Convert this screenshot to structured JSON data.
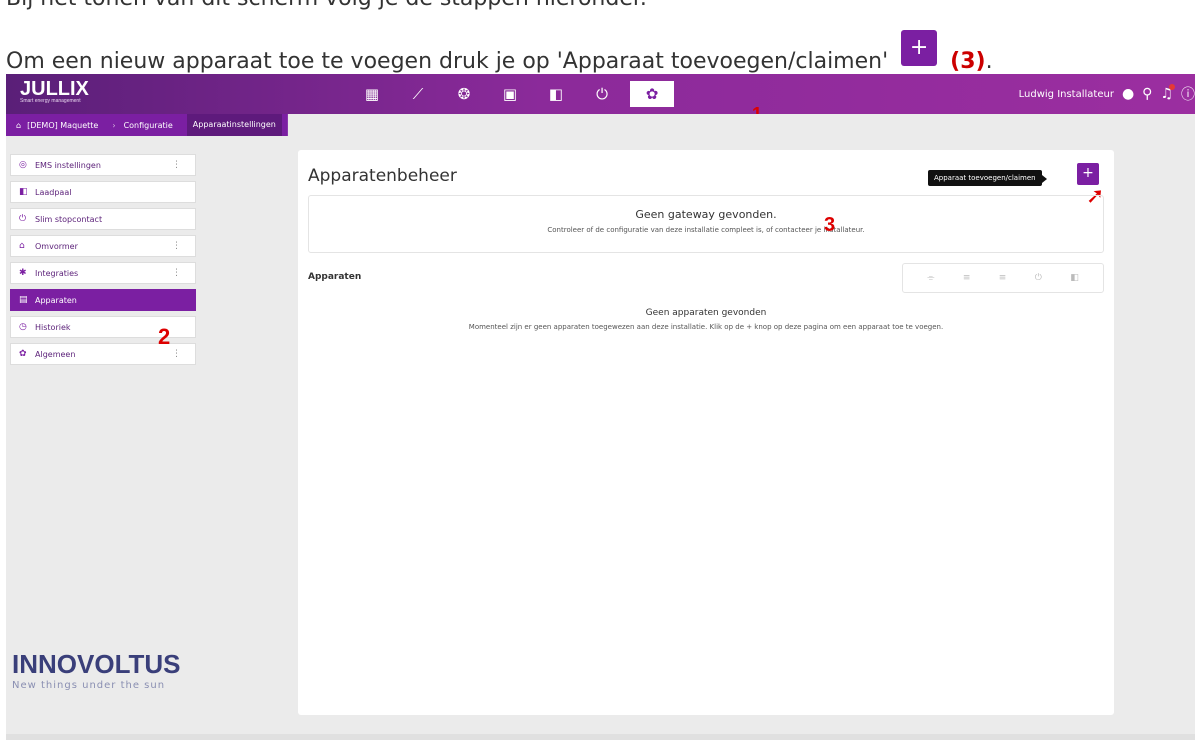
{
  "doc": {
    "top_line": "Bij het tonen van dit scherm volg je de stappen hieronder.",
    "instruction_prefix": "Om een nieuw apparaat toe te voegen druk je op 'Apparaat toevoegen/claimen'",
    "instruction_ref": "(3)",
    "instruction_suffix": "."
  },
  "app": {
    "logo": "JULLIX",
    "logo_tagline": "Smart energy management",
    "nav": [
      {
        "icon": "dashboard-icon",
        "glyph": "▦"
      },
      {
        "icon": "chart-icon",
        "glyph": "⟋"
      },
      {
        "icon": "brain-icon",
        "glyph": "❂"
      },
      {
        "icon": "battery-icon",
        "glyph": "▣"
      },
      {
        "icon": "charger-icon",
        "glyph": "◧"
      },
      {
        "icon": "plug-icon",
        "glyph": "⏻"
      },
      {
        "icon": "settings-icon",
        "glyph": "✿"
      }
    ],
    "markers": {
      "one": "1",
      "two": "2",
      "three": "3"
    },
    "user": {
      "name": "Ludwig Installateur"
    },
    "breadcrumbs": [
      "[DEMO] Maquette",
      "Configuratie",
      "Apparaatinstellingen"
    ],
    "sidebar": [
      {
        "label": "EMS instellingen",
        "glyph": "◎",
        "icon": "ems-icon",
        "more": "⋮"
      },
      {
        "label": "Laadpaal",
        "glyph": "◧",
        "icon": "charger-icon",
        "more": ""
      },
      {
        "label": "Slim stopcontact",
        "glyph": "⏻",
        "icon": "plug-icon",
        "more": ""
      },
      {
        "label": "Omvormer",
        "glyph": "⌂",
        "icon": "inverter-icon",
        "more": "⋮"
      },
      {
        "label": "Integraties",
        "glyph": "✱",
        "icon": "puzzle-icon",
        "more": "⋮"
      },
      {
        "label": "Apparaten",
        "glyph": "▤",
        "icon": "devices-icon",
        "more": ""
      },
      {
        "label": "Historiek",
        "glyph": "◷",
        "icon": "history-icon",
        "more": ""
      },
      {
        "label": "Algemeen",
        "glyph": "✿",
        "icon": "gear-icon",
        "more": "⋮"
      }
    ],
    "brand": {
      "name": "INNOVOLTUS",
      "slogan": "New things under the sun"
    },
    "main": {
      "title": "Apparatenbeheer",
      "tooltip": "Apparaat toevoegen/claimen",
      "add_label": "+",
      "notice_title": "Geen gateway gevonden.",
      "notice_text": "Controleer of de configuratie van deze installatie compleet is, of contacteer je installateur.",
      "devices_heading": "Apparaten",
      "filters": [
        "⌯",
        "≡",
        "≡",
        "⏻",
        "◧"
      ],
      "empty_title": "Geen apparaten gevonden",
      "empty_text": "Momenteel zijn er geen apparaten toegewezen aan deze installatie. Klik op de + knop op deze pagina om een apparaat toe te voegen."
    }
  }
}
